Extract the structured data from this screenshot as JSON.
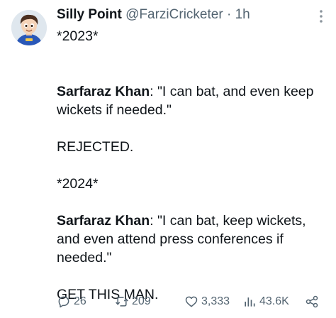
{
  "author": {
    "name": "Silly Point",
    "handle": "@FarziCricketer",
    "separator": "·",
    "time": "1h"
  },
  "tweet": {
    "line1": "*2023*",
    "quote1_speaker": "Sarfaraz Khan",
    "quote1_text": ": \"I can bat, and even keep wickets if needed.\"",
    "line_rejected": "REJECTED.",
    "line2": "*2024*",
    "quote2_speaker": "Sarfaraz Khan",
    "quote2_text": ": \"I can bat, keep wickets, and even attend press conferences if needed.\"",
    "line_final": "GET THIS MAN."
  },
  "actions": {
    "replies": "26",
    "retweets": "209",
    "likes": "3,333",
    "views": "43.6K"
  },
  "colors": {
    "text": "#0f1419",
    "secondary": "#536471"
  },
  "icons": {
    "reply": "reply-icon",
    "retweet": "retweet-icon",
    "like": "heart-icon",
    "views": "views-icon",
    "share": "share-icon",
    "more": "more-icon",
    "avatar": "cartoon-cricketer-avatar"
  }
}
